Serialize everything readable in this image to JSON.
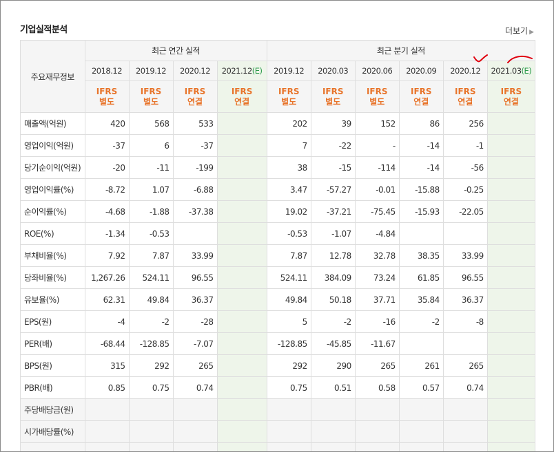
{
  "section_title": "기업실적분석",
  "more_link": "더보기",
  "header": {
    "row_label": "주요재무정보",
    "annual_group": "최근 연간 실적",
    "quarter_group": "최근 분기 실적",
    "periods": [
      {
        "label": "2018.12",
        "ifrs": "IFRS",
        "basis": "별도"
      },
      {
        "label": "2019.12",
        "ifrs": "IFRS",
        "basis": "별도"
      },
      {
        "label": "2020.12",
        "ifrs": "IFRS",
        "basis": "연결"
      },
      {
        "label": "2021.12",
        "est": "(E)",
        "ifrs": "IFRS",
        "basis": "연결"
      },
      {
        "label": "2019.12",
        "ifrs": "IFRS",
        "basis": "별도"
      },
      {
        "label": "2020.03",
        "ifrs": "IFRS",
        "basis": "별도"
      },
      {
        "label": "2020.06",
        "ifrs": "IFRS",
        "basis": "별도"
      },
      {
        "label": "2020.09",
        "ifrs": "IFRS",
        "basis": "연결"
      },
      {
        "label": "2020.12",
        "ifrs": "IFRS",
        "basis": "연결"
      },
      {
        "label": "2021.03",
        "est": "(E)",
        "ifrs": "IFRS",
        "basis": "연결"
      }
    ]
  },
  "rows": [
    {
      "label": "매출액(억원)",
      "values": [
        "420",
        "568",
        "533",
        "",
        "202",
        "39",
        "152",
        "86",
        "256",
        ""
      ]
    },
    {
      "label": "영업이익(억원)",
      "values": [
        "-37",
        "6",
        "-37",
        "",
        "7",
        "-22",
        "-",
        "-14",
        "-1",
        ""
      ]
    },
    {
      "label": "당기순이익(억원)",
      "values": [
        "-20",
        "-11",
        "-199",
        "",
        "38",
        "-15",
        "-114",
        "-14",
        "-56",
        ""
      ]
    },
    {
      "label": "영업이익률(%)",
      "values": [
        "-8.72",
        "1.07",
        "-6.88",
        "",
        "3.47",
        "-57.27",
        "-0.01",
        "-15.88",
        "-0.25",
        ""
      ]
    },
    {
      "label": "순이익률(%)",
      "values": [
        "-4.68",
        "-1.88",
        "-37.38",
        "",
        "19.02",
        "-37.21",
        "-75.45",
        "-15.93",
        "-22.05",
        ""
      ]
    },
    {
      "label": "ROE(%)",
      "values": [
        "-1.34",
        "-0.53",
        "",
        "",
        "-0.53",
        "-1.07",
        "-4.84",
        "",
        "",
        ""
      ]
    },
    {
      "label": "부채비율(%)",
      "values": [
        "7.92",
        "7.87",
        "33.99",
        "",
        "7.87",
        "12.78",
        "32.78",
        "38.35",
        "33.99",
        ""
      ]
    },
    {
      "label": "당좌비율(%)",
      "values": [
        "1,267.26",
        "524.11",
        "96.55",
        "",
        "524.11",
        "384.09",
        "73.24",
        "61.85",
        "96.55",
        ""
      ]
    },
    {
      "label": "유보율(%)",
      "values": [
        "62.31",
        "49.84",
        "36.37",
        "",
        "49.84",
        "50.18",
        "37.71",
        "35.84",
        "36.37",
        ""
      ]
    },
    {
      "label": "EPS(원)",
      "values": [
        "-4",
        "-2",
        "-28",
        "",
        "5",
        "-2",
        "-16",
        "-2",
        "-8",
        ""
      ]
    },
    {
      "label": "PER(배)",
      "values": [
        "-68.44",
        "-128.85",
        "-7.07",
        "",
        "-128.85",
        "-45.85",
        "-11.67",
        "",
        "",
        ""
      ]
    },
    {
      "label": "BPS(원)",
      "values": [
        "315",
        "292",
        "265",
        "",
        "292",
        "290",
        "265",
        "261",
        "265",
        ""
      ]
    },
    {
      "label": "PBR(배)",
      "values": [
        "0.85",
        "0.75",
        "0.74",
        "",
        "0.75",
        "0.51",
        "0.58",
        "0.57",
        "0.74",
        ""
      ]
    },
    {
      "label": "주당배당금(원)",
      "values": [
        "",
        "",
        "",
        "",
        "",
        "",
        "",
        "",
        "",
        ""
      ]
    },
    {
      "label": "시가배당률(%)",
      "values": [
        "",
        "",
        "",
        "",
        "",
        "",
        "",
        "",
        "",
        ""
      ]
    },
    {
      "label": "",
      "values": [
        "",
        "",
        "",
        "",
        "",
        "",
        "",
        "",
        "",
        ""
      ]
    }
  ],
  "colors": {
    "negative": "#d0021b",
    "ifrs": "#e8742a",
    "estimate_bg": "#eef5ea",
    "annotation": "#e0000f"
  }
}
